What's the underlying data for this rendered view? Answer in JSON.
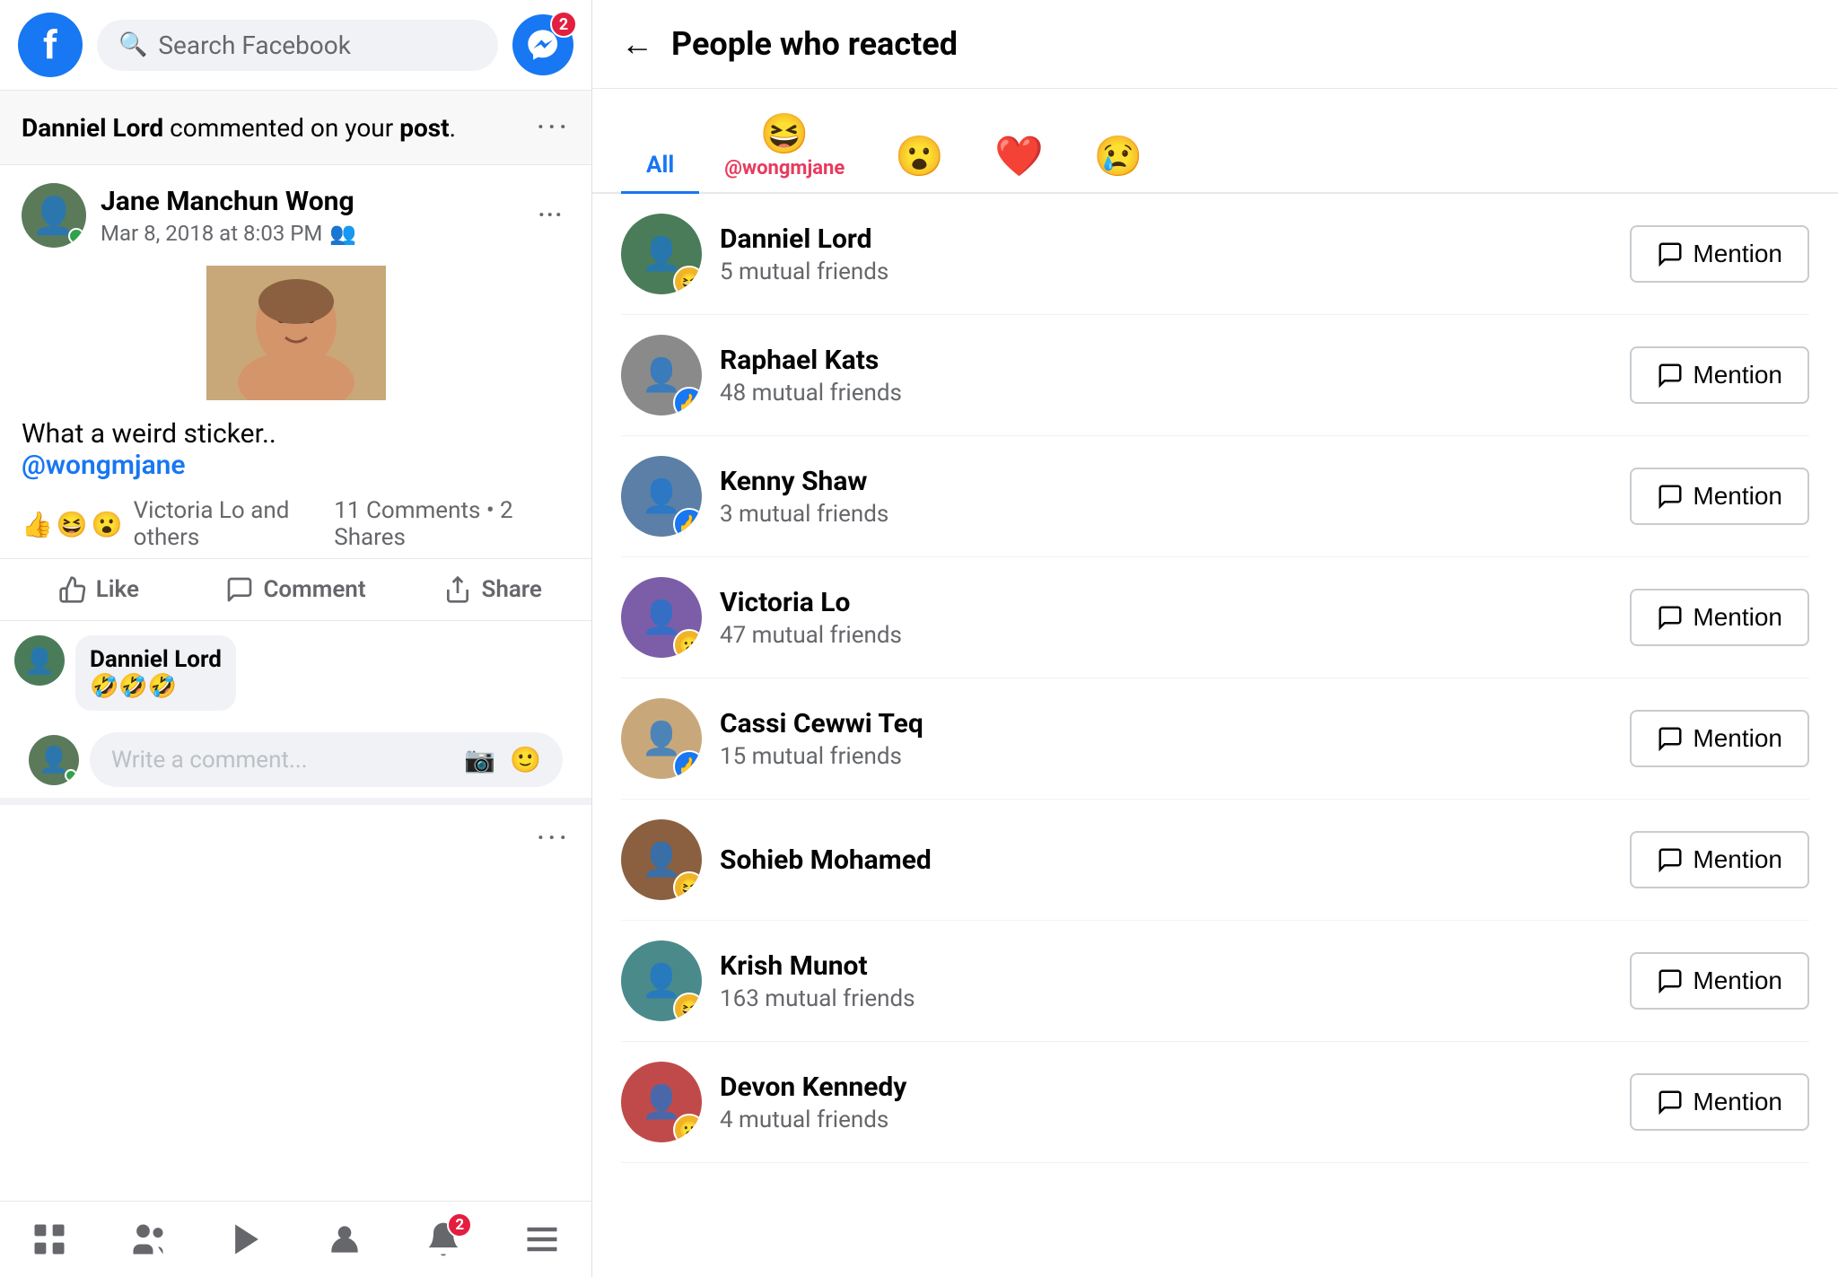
{
  "header": {
    "search_placeholder": "Search Facebook",
    "messenger_badge": "2",
    "fb_logo": "f"
  },
  "notification": {
    "text_start": "Danniel Lord",
    "text_mid": " commented on your ",
    "text_bold": "post",
    "text_end": ".",
    "more_dots": "···"
  },
  "post": {
    "author": "Jane Manchun Wong",
    "date": "Mar 8, 2018 at 8:03 PM",
    "caption": "What a weird sticker..",
    "mention": "@wongmjane",
    "reactions_text": "Victoria Lo and others",
    "stats": "11 Comments • 2 Shares",
    "like_label": "Like",
    "comment_label": "Comment",
    "share_label": "Share",
    "more_dots": "···"
  },
  "comment": {
    "author": "Danniel Lord",
    "text": "🤣🤣🤣",
    "input_placeholder": "Write a comment..."
  },
  "bottom_nav": {
    "badge": "2"
  },
  "right_panel": {
    "back_label": "←",
    "title": "People who reacted",
    "tabs": [
      {
        "id": "all",
        "label": "All",
        "emoji": "",
        "mention": ""
      },
      {
        "id": "haha",
        "label": "",
        "emoji": "😆",
        "mention": "@wongmjane"
      },
      {
        "id": "wow",
        "label": "",
        "emoji": "😮",
        "mention": ""
      },
      {
        "id": "love",
        "label": "",
        "emoji": "❤️",
        "mention": ""
      },
      {
        "id": "sad",
        "label": "",
        "emoji": "😢",
        "mention": ""
      }
    ],
    "people": [
      {
        "name": "Danniel Lord",
        "mutual": "5 mutual friends",
        "reaction": "😆",
        "reaction_bg": "#f0b429",
        "av_class": "av-green"
      },
      {
        "name": "Raphael Kats",
        "mutual": "48 mutual friends",
        "reaction": "👍",
        "reaction_bg": "#1877f2",
        "av_class": "av-gray"
      },
      {
        "name": "Kenny Shaw",
        "mutual": "3 mutual friends",
        "reaction": "👍",
        "reaction_bg": "#1877f2",
        "av_class": "av-blue"
      },
      {
        "name": "Victoria Lo",
        "mutual": "47 mutual friends",
        "reaction": "😮",
        "reaction_bg": "#f0b429",
        "av_class": "av-purple"
      },
      {
        "name": "Cassi Cewwi Teq",
        "mutual": "15 mutual friends",
        "reaction": "👍",
        "reaction_bg": "#1877f2",
        "av_class": "av-beige"
      },
      {
        "name": "Sohieb Mohamed",
        "mutual": "",
        "reaction": "😆",
        "reaction_bg": "#f0b429",
        "av_class": "av-brown"
      },
      {
        "name": "Krish Munot",
        "mutual": "163 mutual friends",
        "reaction": "😆",
        "reaction_bg": "#f0b429",
        "av_class": "av-teal"
      },
      {
        "name": "Devon Kennedy",
        "mutual": "4 mutual friends",
        "reaction": "😮",
        "reaction_bg": "#f0b429",
        "av_class": "av-red"
      }
    ],
    "mention_label": "Mention"
  }
}
